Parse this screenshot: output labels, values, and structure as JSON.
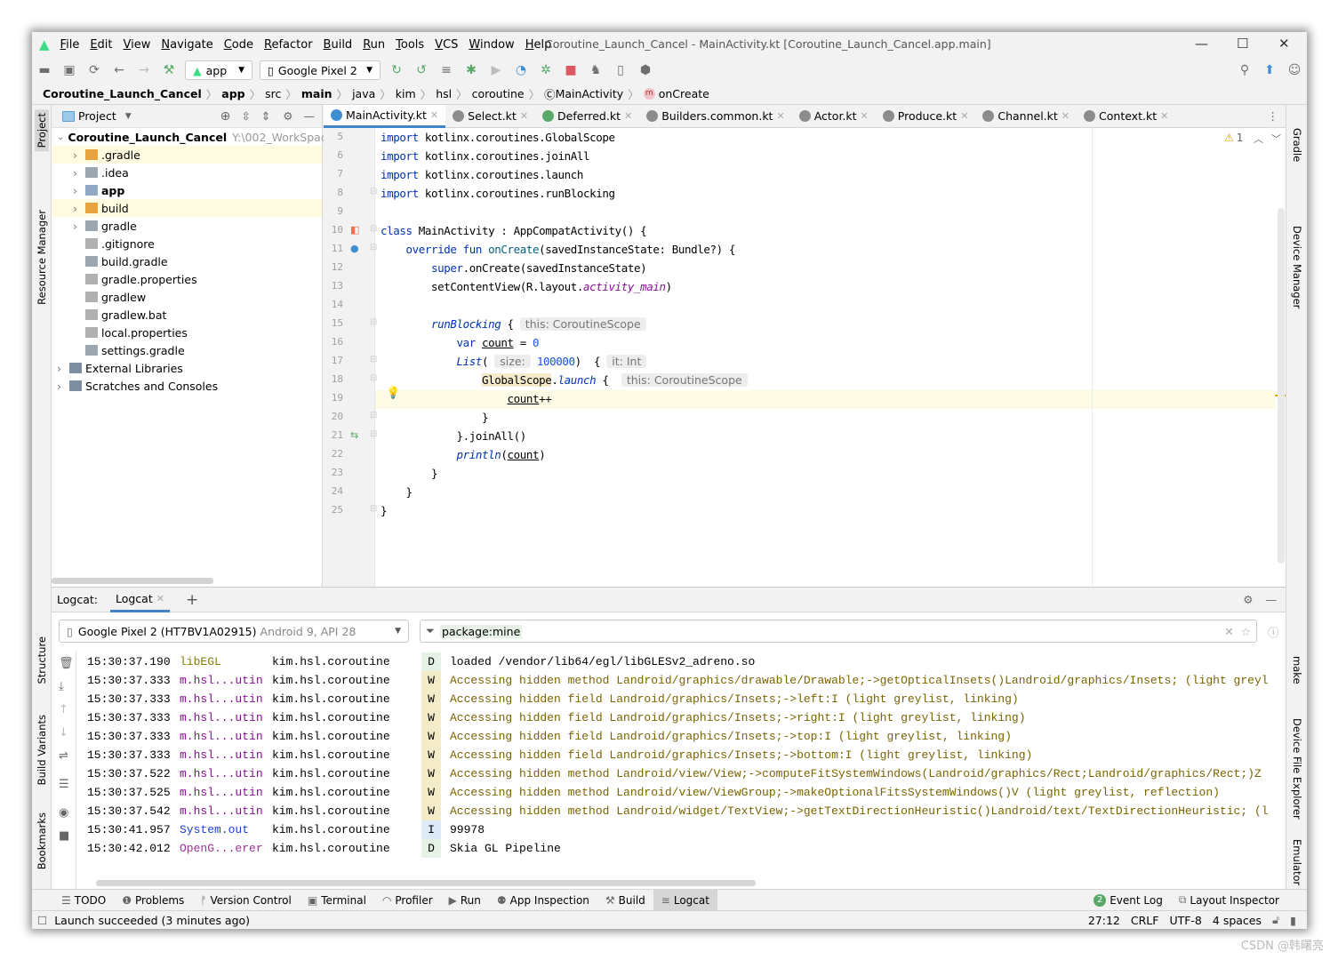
{
  "window": {
    "title": "Coroutine_Launch_Cancel - MainActivity.kt [Coroutine_Launch_Cancel.app.main]"
  },
  "menu": [
    "File",
    "Edit",
    "View",
    "Navigate",
    "Code",
    "Refactor",
    "Build",
    "Run",
    "Tools",
    "VCS",
    "Window",
    "Help"
  ],
  "toolbar": {
    "run_config": "app",
    "device": "Google Pixel 2"
  },
  "breadcrumb": [
    "Coroutine_Launch_Cancel",
    "app",
    "src",
    "main",
    "java",
    "kim",
    "hsl",
    "coroutine",
    "MainActivity",
    "onCreate"
  ],
  "left_stripe": [
    "Project",
    "Resource Manager",
    "Structure",
    "Build Variants",
    "Bookmarks"
  ],
  "right_stripe": [
    "Gradle",
    "Device Manager",
    "make",
    "Device File Explorer",
    "Emulator"
  ],
  "project": {
    "header": "Project",
    "root": "Coroutine_Launch_Cancel",
    "root_path": "Y:\\002_WorkSpace",
    "items": [
      {
        "label": ".gradle",
        "type": "folder-orange",
        "indent": 1,
        "expandable": true,
        "selected": true
      },
      {
        "label": ".idea",
        "type": "folder",
        "indent": 1,
        "expandable": true
      },
      {
        "label": "app",
        "type": "folder-module",
        "indent": 1,
        "expandable": true,
        "bold": true
      },
      {
        "label": "build",
        "type": "folder-orange",
        "indent": 1,
        "expandable": true,
        "selected": true
      },
      {
        "label": "gradle",
        "type": "folder",
        "indent": 1,
        "expandable": true
      },
      {
        "label": ".gitignore",
        "type": "file",
        "indent": 1
      },
      {
        "label": "build.gradle",
        "type": "gradle",
        "indent": 1
      },
      {
        "label": "gradle.properties",
        "type": "file",
        "indent": 1
      },
      {
        "label": "gradlew",
        "type": "file",
        "indent": 1
      },
      {
        "label": "gradlew.bat",
        "type": "file",
        "indent": 1
      },
      {
        "label": "local.properties",
        "type": "file",
        "indent": 1
      },
      {
        "label": "settings.gradle",
        "type": "gradle",
        "indent": 1
      },
      {
        "label": "External Libraries",
        "type": "lib",
        "indent": 0,
        "expandable": true
      },
      {
        "label": "Scratches and Consoles",
        "type": "scratch",
        "indent": 0,
        "expandable": true
      }
    ]
  },
  "tabs": [
    {
      "label": "MainActivity.kt",
      "active": true,
      "color": "#3d8fd1"
    },
    {
      "label": "Select.kt",
      "color": "#8c8c8c"
    },
    {
      "label": "Deferred.kt",
      "color": "#59a869"
    },
    {
      "label": "Builders.common.kt",
      "color": "#8c8c8c"
    },
    {
      "label": "Actor.kt",
      "color": "#8c8c8c"
    },
    {
      "label": "Produce.kt",
      "color": "#8c8c8c"
    },
    {
      "label": "Channel.kt",
      "color": "#8c8c8c"
    },
    {
      "label": "Context.kt",
      "color": "#8c8c8c"
    }
  ],
  "editor": {
    "warnings": "1",
    "current_line": 19,
    "lines": [
      {
        "n": 5,
        "t": [
          [
            "import ",
            "kw"
          ],
          [
            "kotlinx.coroutines.GlobalScope",
            ""
          ]
        ]
      },
      {
        "n": 6,
        "t": [
          [
            "import ",
            "kw"
          ],
          [
            "kotlinx.coroutines.joinAll",
            ""
          ]
        ]
      },
      {
        "n": 7,
        "t": [
          [
            "import ",
            "kw"
          ],
          [
            "kotlinx.coroutines.launch",
            ""
          ]
        ]
      },
      {
        "n": 8,
        "t": [
          [
            "import ",
            "kw"
          ],
          [
            "kotlinx.coroutines.runBlocking",
            ""
          ]
        ]
      },
      {
        "n": 9,
        "t": []
      },
      {
        "n": 10,
        "t": [
          [
            "class ",
            "kw"
          ],
          [
            "MainActivity : AppCompatActivity() {",
            ""
          ]
        ]
      },
      {
        "n": 11,
        "t": [
          [
            "    override fun ",
            "kw"
          ],
          [
            "onCreate",
            "fn"
          ],
          [
            "(savedInstanceState: Bundle?) {",
            ""
          ]
        ]
      },
      {
        "n": 12,
        "t": [
          [
            "        super",
            "kw"
          ],
          [
            ".onCreate(savedInstanceState)",
            ""
          ]
        ]
      },
      {
        "n": 13,
        "t": [
          [
            "        setContentView(R.layout.",
            ""
          ],
          [
            "activity_main",
            "pu"
          ],
          [
            ")",
            ""
          ]
        ]
      },
      {
        "n": 14,
        "t": []
      },
      {
        "n": 15,
        "t": [
          [
            "        ",
            ""
          ],
          [
            "runBlocking",
            "it"
          ],
          [
            " { ",
            ""
          ],
          [
            "this: CoroutineScope",
            "hint"
          ]
        ]
      },
      {
        "n": 16,
        "t": [
          [
            "            var ",
            "kw"
          ],
          [
            "count",
            "ul"
          ],
          [
            " = ",
            ""
          ],
          [
            "0",
            "nm"
          ]
        ]
      },
      {
        "n": 17,
        "t": [
          [
            "            ",
            ""
          ],
          [
            "List",
            "it"
          ],
          [
            "( ",
            ""
          ],
          [
            "size:",
            "hint"
          ],
          [
            " ",
            ""
          ],
          [
            "100000",
            "nm"
          ],
          [
            ")  { ",
            ""
          ],
          [
            "it: Int",
            "hint"
          ]
        ]
      },
      {
        "n": 18,
        "t": [
          [
            "                ",
            ""
          ],
          [
            "GlobalScope",
            "hl"
          ],
          [
            ".",
            ""
          ],
          [
            "launch",
            "it"
          ],
          [
            " {  ",
            ""
          ],
          [
            "this: CoroutineScope",
            "hint"
          ]
        ]
      },
      {
        "n": 19,
        "t": [
          [
            "                    ",
            ""
          ],
          [
            "count",
            "ul"
          ],
          [
            "++",
            ""
          ]
        ]
      },
      {
        "n": 20,
        "t": [
          [
            "                }",
            ""
          ]
        ]
      },
      {
        "n": 21,
        "t": [
          [
            "            }.joinAll()",
            ""
          ]
        ]
      },
      {
        "n": 22,
        "t": [
          [
            "            ",
            ""
          ],
          [
            "println",
            "it"
          ],
          [
            "(",
            ""
          ],
          [
            "count",
            "ul"
          ],
          [
            ")",
            ""
          ]
        ]
      },
      {
        "n": 23,
        "t": [
          [
            "        }",
            ""
          ]
        ]
      },
      {
        "n": 24,
        "t": [
          [
            "    }",
            ""
          ]
        ]
      },
      {
        "n": 25,
        "t": [
          [
            "}",
            ""
          ]
        ]
      }
    ]
  },
  "logcat": {
    "label": "Logcat:",
    "tab": "Logcat",
    "device": "Google Pixel 2 (HT7BV1A02915)",
    "device_detail": "Android 9, API 28",
    "filter": "package:mine",
    "rows": [
      {
        "time": "15:30:37.190",
        "tag": "libEGL",
        "tagcolor": "#808000",
        "pkg": "kim.hsl.coroutine",
        "level": "D",
        "msg": "loaded /vendor/lib64/egl/libGLESv2_adreno.so"
      },
      {
        "time": "15:30:37.333",
        "tag": "m.hsl...utin",
        "tagcolor": "#871094",
        "pkg": "kim.hsl.coroutine",
        "level": "W",
        "msg": "Accessing hidden method Landroid/graphics/drawable/Drawable;->getOpticalInsets()Landroid/graphics/Insets; (light greyl"
      },
      {
        "time": "15:30:37.333",
        "tag": "m.hsl...utin",
        "tagcolor": "#871094",
        "pkg": "kim.hsl.coroutine",
        "level": "W",
        "msg": "Accessing hidden field Landroid/graphics/Insets;->left:I (light greylist, linking)"
      },
      {
        "time": "15:30:37.333",
        "tag": "m.hsl...utin",
        "tagcolor": "#871094",
        "pkg": "kim.hsl.coroutine",
        "level": "W",
        "msg": "Accessing hidden field Landroid/graphics/Insets;->right:I (light greylist, linking)"
      },
      {
        "time": "15:30:37.333",
        "tag": "m.hsl...utin",
        "tagcolor": "#871094",
        "pkg": "kim.hsl.coroutine",
        "level": "W",
        "msg": "Accessing hidden field Landroid/graphics/Insets;->top:I (light greylist, linking)"
      },
      {
        "time": "15:30:37.333",
        "tag": "m.hsl...utin",
        "tagcolor": "#871094",
        "pkg": "kim.hsl.coroutine",
        "level": "W",
        "msg": "Accessing hidden field Landroid/graphics/Insets;->bottom:I (light greylist, linking)"
      },
      {
        "time": "15:30:37.522",
        "tag": "m.hsl...utin",
        "tagcolor": "#871094",
        "pkg": "kim.hsl.coroutine",
        "level": "W",
        "msg": "Accessing hidden method Landroid/view/View;->computeFitSystemWindows(Landroid/graphics/Rect;Landroid/graphics/Rect;)Z"
      },
      {
        "time": "15:30:37.525",
        "tag": "m.hsl...utin",
        "tagcolor": "#871094",
        "pkg": "kim.hsl.coroutine",
        "level": "W",
        "msg": "Accessing hidden method Landroid/view/ViewGroup;->makeOptionalFitsSystemWindows()V (light greylist, reflection)"
      },
      {
        "time": "15:30:37.542",
        "tag": "m.hsl...utin",
        "tagcolor": "#871094",
        "pkg": "kim.hsl.coroutine",
        "level": "W",
        "msg": "Accessing hidden method Landroid/widget/TextView;->getTextDirectionHeuristic()Landroid/text/TextDirectionHeuristic; (l"
      },
      {
        "time": "15:30:41.957",
        "tag": "System.out",
        "tagcolor": "#1a3fd8",
        "pkg": "kim.hsl.coroutine",
        "level": "I",
        "msg": "99978"
      },
      {
        "time": "15:30:42.012",
        "tag": "OpenG...erer",
        "tagcolor": "#a0309b",
        "pkg": "kim.hsl.coroutine",
        "level": "D",
        "msg": "Skia GL Pipeline"
      }
    ]
  },
  "level_colors": {
    "D": "#e6f2e6",
    "W": "#f4ebc8",
    "I": "#dcebf7"
  },
  "warn_msg_color": "#7a6400",
  "bottom_tabs": [
    {
      "label": "TODO",
      "icon": "list-icon"
    },
    {
      "label": "Problems",
      "icon": "problems-icon"
    },
    {
      "label": "Version Control",
      "icon": "vcs-icon"
    },
    {
      "label": "Terminal",
      "icon": "terminal-icon"
    },
    {
      "label": "Profiler",
      "icon": "profiler-icon"
    },
    {
      "label": "Run",
      "icon": "run-icon"
    },
    {
      "label": "App Inspection",
      "icon": "inspection-icon"
    },
    {
      "label": "Build",
      "icon": "hammer-icon"
    },
    {
      "label": "Logcat",
      "icon": "logcat-icon",
      "active": true
    }
  ],
  "event_log": {
    "label": "Event Log",
    "count": "2"
  },
  "layout_inspector": "Layout Inspector",
  "status": {
    "message": "Launch succeeded (3 minutes ago)",
    "position": "27:12",
    "line_sep": "CRLF",
    "encoding": "UTF-8",
    "indent": "4 spaces"
  },
  "watermark": "CSDN @韩曙亮"
}
